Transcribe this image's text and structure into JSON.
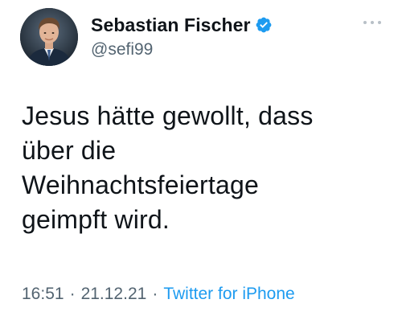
{
  "tweet": {
    "author": {
      "display_name": "Sebastian Fischer",
      "handle": "@sefi99",
      "verified": true
    },
    "text": "Jesus hätte gewollt, dass\nüber die\nWeihnachtsfeiertage\ngeimpft wird.",
    "time": "16:51",
    "date": "21.12.21",
    "source": "Twitter for iPhone",
    "separator": "·"
  },
  "icons": {
    "verified": "verified-badge-icon",
    "more": "more-options-icon"
  },
  "colors": {
    "accent": "#1d9bf0",
    "text_primary": "#0f1419",
    "text_secondary": "#536471"
  }
}
